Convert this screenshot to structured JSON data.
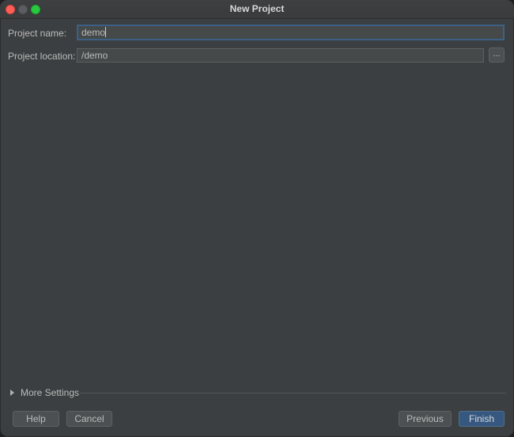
{
  "window": {
    "title": "New Project"
  },
  "form": {
    "name_label": "Project name:",
    "name_value": "demo",
    "location_label": "Project location:",
    "location_value": "/demo",
    "browse_label": "..."
  },
  "more_settings": {
    "label": "More Settings"
  },
  "footer": {
    "help": "Help",
    "cancel": "Cancel",
    "previous": "Previous",
    "finish": "Finish"
  },
  "colors": {
    "background": "#3c3f41",
    "primary_button": "#365880",
    "focus_border": "#3d6185"
  }
}
